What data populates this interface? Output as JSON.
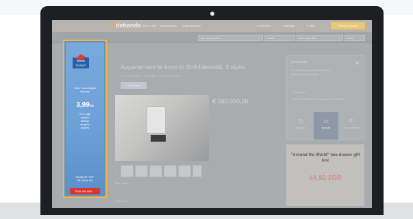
{
  "header": {
    "logo": "dehands",
    "links": [
      "Help en info",
      "Voorwaarden",
      "Veilig handelen"
    ],
    "messages": "Berichten",
    "favorites": "Watchlijst",
    "user": "Mijn",
    "post_button": "Plaats zoekertje"
  },
  "search": {
    "category": "Alle categorieën",
    "postcode": "Gratis",
    "distance": "Alle afstanden",
    "search_btn": "Zoek"
  },
  "ad": {
    "brand": "TELENET",
    "line1": "Onze voordeligste",
    "line2": "formule",
    "price": "3,99",
    "line3": "Zo'n lage",
    "line4": "prijzen",
    "line5": "vindt je",
    "line6": "nergens",
    "line7": "anders",
    "bottom1": "PLAN OF TOP",
    "bottom2": "DE DEAL NU",
    "cta": "Doe uw aan..."
  },
  "listing": {
    "title": "Appartement te koop in Sint-Idesbald, 3 slpks",
    "meta": "Zo 1 uur geleden · 5 bekeken · Gebruikt op 12 juni",
    "save_label": "Bewaar",
    "price": "€ 340.000,00",
    "more_photos": "Meer foto's",
    "section_label": "Kenmerken"
  },
  "panel": {
    "title": "Gemeente",
    "sub1": "Je ouders ingevuld op Gemeente",
    "sub2": "Bekijk meer zoekertjes",
    "radio1": "Lindegem",
    "radio2": "Werk een bericht / vraag aan Sint-Idesbald",
    "actions": [
      "Bewaren",
      "Bericht",
      "Toon nummer"
    ]
  },
  "ad2": {
    "text": "\"Around the World\" two-drawer gift box",
    "price": "44,92 £GB"
  },
  "colors": {
    "ad_border": "#f4b63e",
    "ad_bg": "#6da0d6",
    "cta_bg": "#e0332d",
    "post_btn": "#e8c873"
  }
}
